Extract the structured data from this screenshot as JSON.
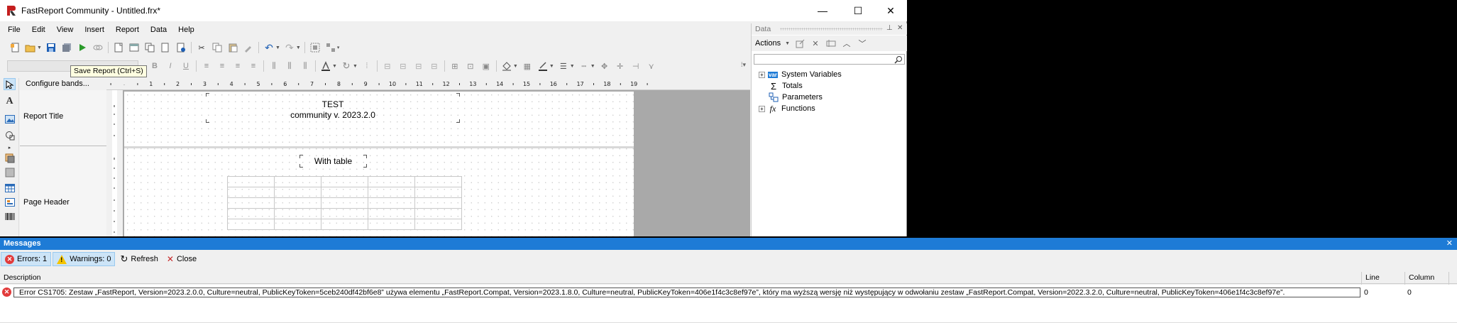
{
  "window": {
    "title": "FastReport Community - Untitled.frx*",
    "minimize": "—",
    "maximize": "☐",
    "close": "✕"
  },
  "menu": [
    "File",
    "Edit",
    "View",
    "Insert",
    "Report",
    "Data",
    "Help"
  ],
  "tooltip": "Save Report (Ctrl+S)",
  "designer": {
    "configure_bands": "Configure bands...",
    "ruler_marks": [
      "1",
      "2",
      "3",
      "4",
      "5",
      "6",
      "7",
      "8",
      "9",
      "10",
      "11",
      "12",
      "13",
      "14",
      "15",
      "16",
      "17",
      "18",
      "19"
    ],
    "bands": [
      {
        "label": "Report Title"
      },
      {
        "label": "Page Header"
      }
    ],
    "report_title_text": [
      "TEST",
      "community v. 2023.2.0"
    ],
    "page_header_text": "With table"
  },
  "data_panel": {
    "title": "Data",
    "actions_label": "Actions",
    "tree": [
      {
        "label": "System Variables",
        "icon": "var-icon",
        "expandable": true
      },
      {
        "label": "Totals",
        "icon": "sigma-icon",
        "expandable": false
      },
      {
        "label": "Parameters",
        "icon": "parameters-icon",
        "expandable": false
      },
      {
        "label": "Functions",
        "icon": "fx-icon",
        "expandable": true
      }
    ]
  },
  "messages": {
    "title": "Messages",
    "close": "✕",
    "errors_label": "Errors: 1",
    "warnings_label": "Warnings: 0",
    "refresh_label": "Refresh",
    "close_label": "Close",
    "columns": [
      "Description",
      "Line",
      "Column"
    ],
    "rows": [
      {
        "description": "Error CS1705: Zestaw „FastReport, Version=2023.2.0.0, Culture=neutral, PublicKeyToken=5ceb240df42bf6e8” używa elementu „FastReport.Compat, Version=2023.1.8.0, Culture=neutral, PublicKeyToken=406e1f4c3c8ef97e”, który ma wyższą wersję niż występujący w odwołaniu zestaw „FastReport.Compat, Version=2022.3.2.0, Culture=neutral, PublicKeyToken=406e1f4c3c8ef97e”.",
        "line": "0",
        "column": "0"
      }
    ]
  },
  "colors": {
    "accent": "#1e7bd6",
    "error": "#e23b3b",
    "warning": "#f5c400"
  }
}
